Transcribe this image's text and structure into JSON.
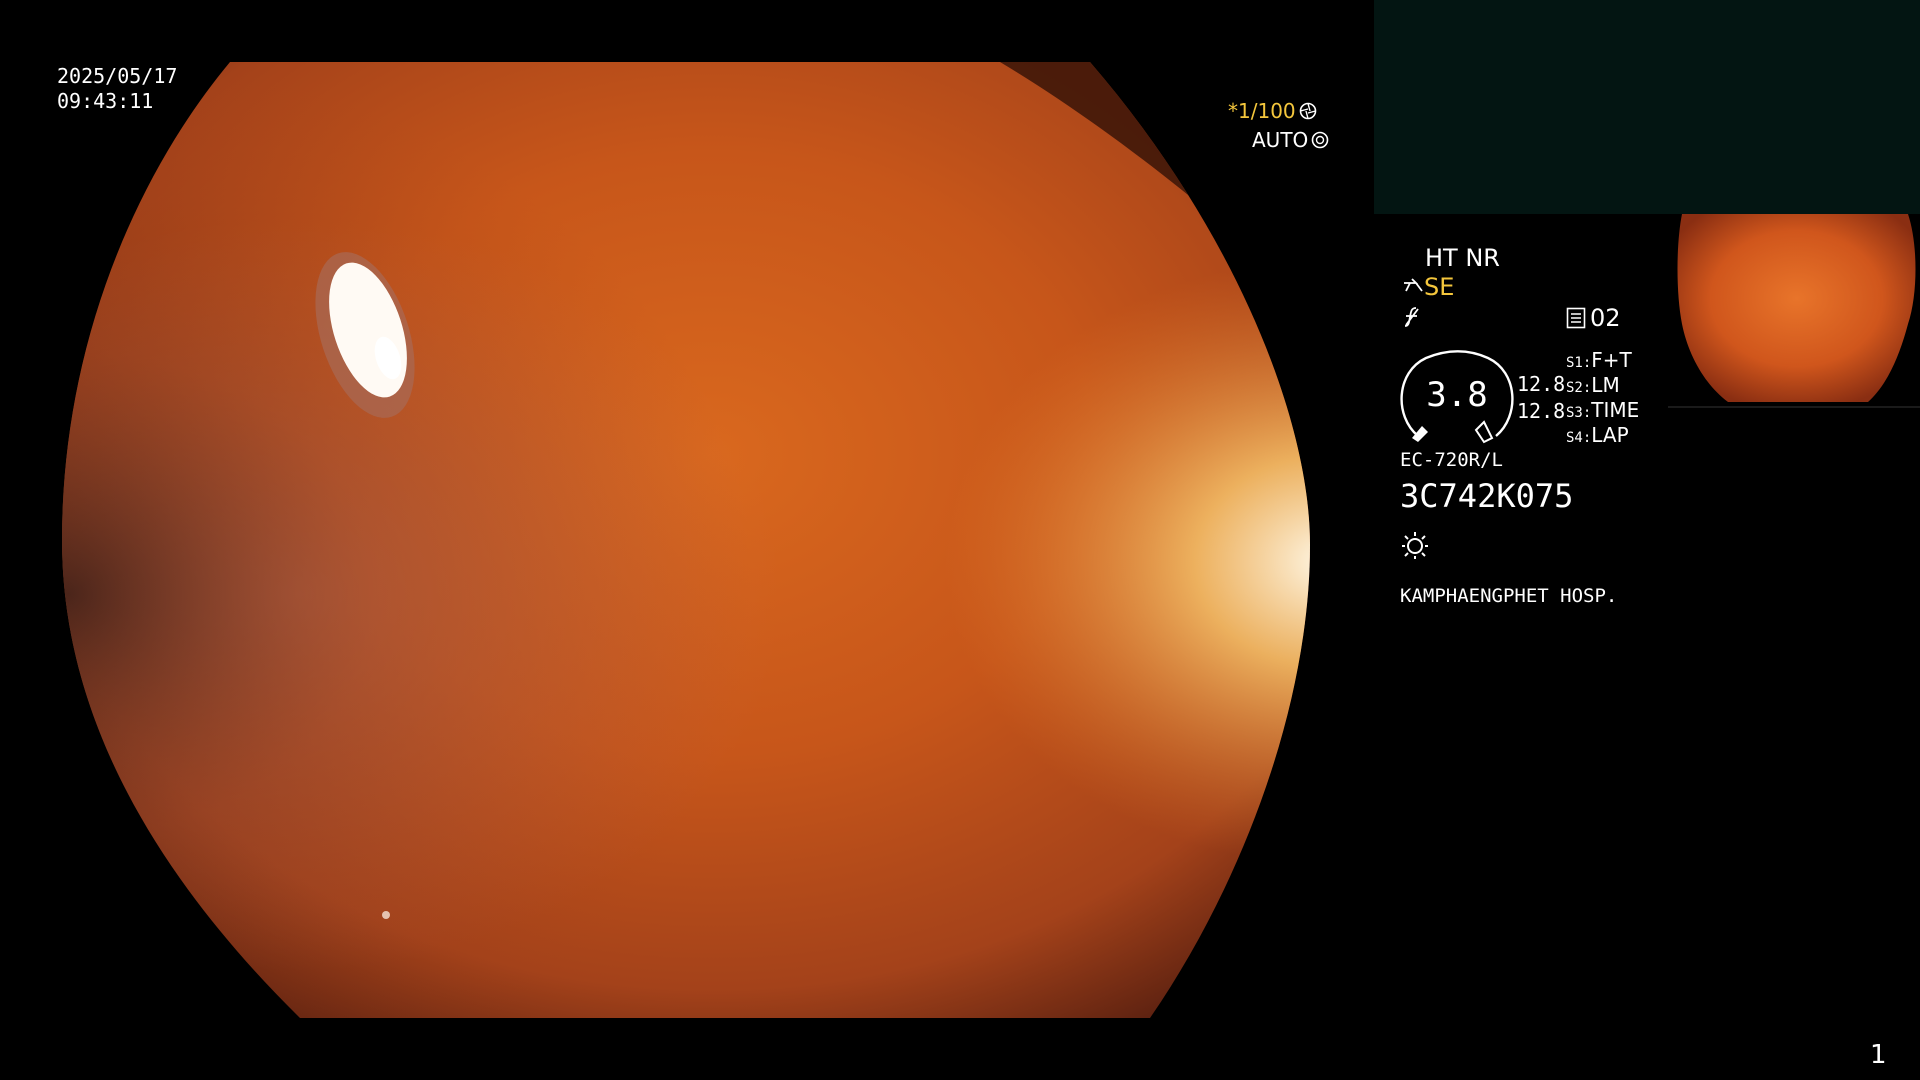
{
  "overlay": {
    "date": "2025/05/17",
    "time": "09:43:11",
    "shutter": "*1/100",
    "iris": "AUTO"
  },
  "panel": {
    "mode": "HT NR",
    "enhance": "SE",
    "memory_label": "02",
    "gauge_value": "3.8",
    "value_a": "12.8",
    "value_b": "12.8",
    "switches": [
      {
        "key": "S1:",
        "label": "F+T"
      },
      {
        "key": "S2:",
        "label": "LM"
      },
      {
        "key": "S3:",
        "label": "TIME"
      },
      {
        "key": "S4:",
        "label": "LAP"
      }
    ],
    "scope_model": "EC-720R/L",
    "scope_serial": "3C742K075",
    "hospital": "KAMPHAENGPHET HOSP."
  },
  "page_number": "1",
  "colors": {
    "accent_yellow": "#f4c63c",
    "tissue_orange": "#c8541c",
    "pip_background": "#031512"
  },
  "icons": [
    "shutter-icon",
    "iris-icon",
    "scope-se-icon",
    "freeze-f-icon",
    "memory-icon",
    "light-icon"
  ]
}
